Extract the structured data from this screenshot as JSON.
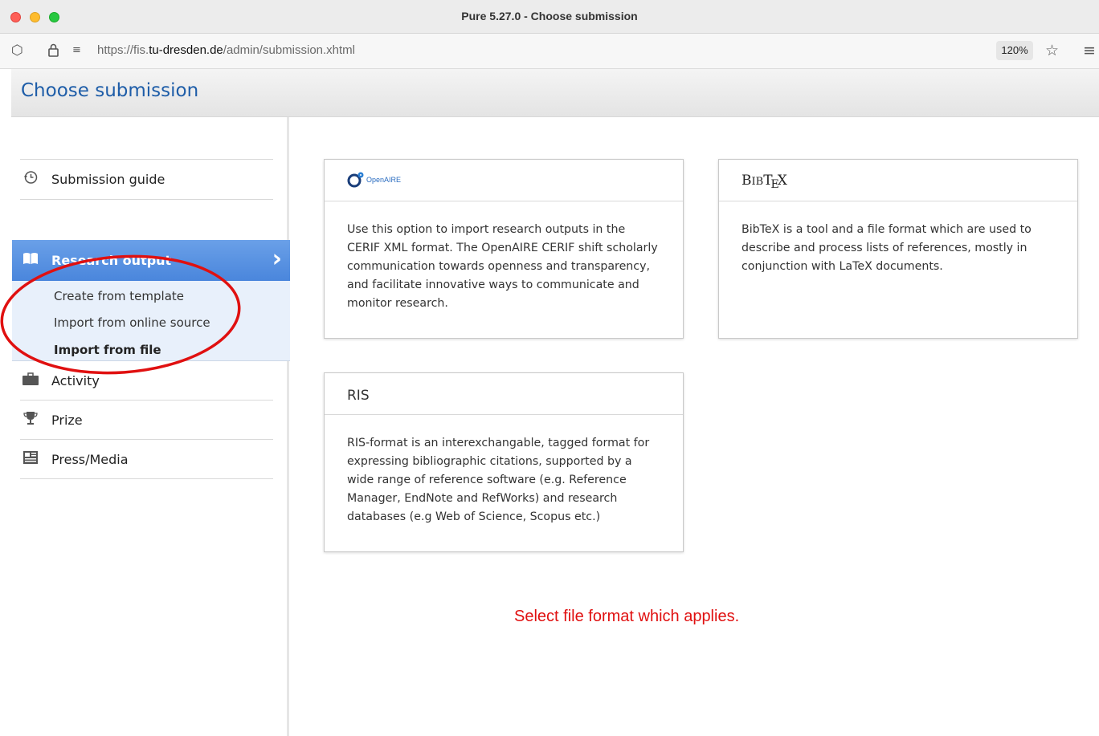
{
  "window": {
    "title": "Pure 5.27.0 - Choose submission"
  },
  "browser": {
    "url_prefix": "https://fis.",
    "url_domain": "tu-dresden.de",
    "url_path": "/admin/submission.xhtml",
    "zoom": "120%"
  },
  "page": {
    "title": "Choose submission"
  },
  "sidebar": {
    "guide": "Submission guide",
    "research_output": "Research output",
    "submenu": [
      "Create from template",
      "Import from online source",
      "Import from file"
    ],
    "items": [
      "Activity",
      "Prize",
      "Press/Media"
    ]
  },
  "cards": {
    "openaire": {
      "logo_text": "OpenAIRE",
      "text": "Use this option to import research outputs in the CERIF XML format. The OpenAIRE CERIF shift scholarly communication towards openness and transparency, and facilitate innovative ways to communicate and monitor research."
    },
    "bibtex": {
      "logo_parts": [
        "B",
        "IB",
        "T",
        "E",
        "X"
      ],
      "text": "BibTeX is a tool and a file format which are used to describe and process lists of references, mostly in conjunction with LaTeX documents."
    },
    "ris": {
      "title": "RIS",
      "text": "RIS-format is an interexchangable, tagged format for expressing bibliographic citations, supported by a wide range of reference software (e.g. Reference Manager, EndNote and RefWorks) and research databases (e.g Web of Science, Scopus etc.)"
    }
  },
  "annotation": {
    "note": "Select file format which applies."
  },
  "colors": {
    "accent": "#1e5da8",
    "highlight": "#4a86dc",
    "annotation": "#e01010"
  }
}
